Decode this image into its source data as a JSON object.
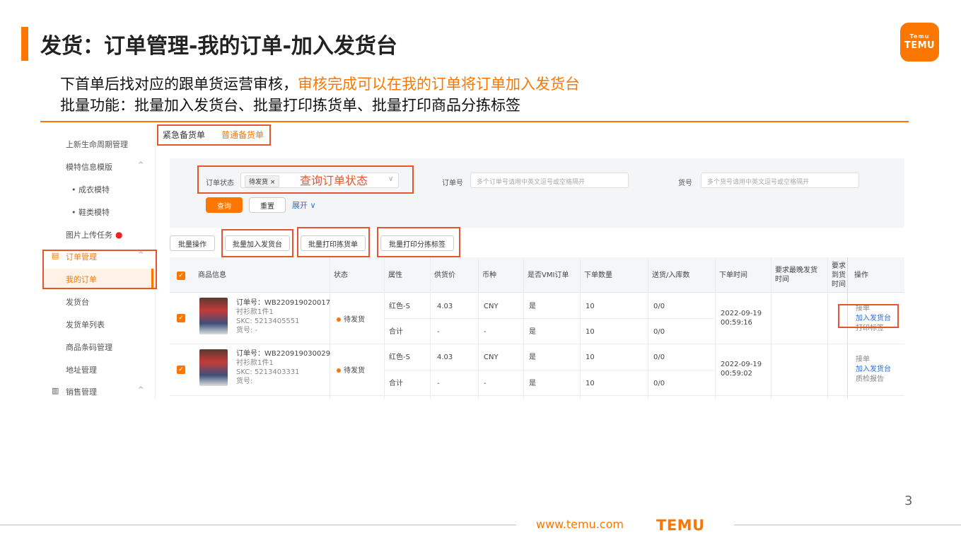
{
  "slide": {
    "title": "发货：订单管理-我的订单-加入发货台",
    "desc_line1_a": "下首单后找对应的跟单货运营审核，",
    "desc_line1_b": "审核完成可以在我的订单将订单加入发货台",
    "desc_line2": "批量功能：批量加入发货台、批量打印拣货单、批量打印商品分拣标签",
    "logo_sub": "Temu",
    "logo_main": "TEMU",
    "page_number": "3",
    "footer_url": "www.temu.com",
    "footer_logo": "TEMU",
    "accent_color": "#fb7701"
  },
  "sidebar": {
    "items": [
      {
        "label": "上新生命周期管理"
      },
      {
        "label": "模特信息模版"
      },
      {
        "label": "• 成衣模特"
      },
      {
        "label": "• 鞋类模特"
      },
      {
        "label": "图片上传任务"
      },
      {
        "label": "订单管理"
      },
      {
        "label": "我的订单"
      },
      {
        "label": "发货台"
      },
      {
        "label": "发货单列表"
      },
      {
        "label": "商品条码管理"
      },
      {
        "label": "地址管理"
      },
      {
        "label": "销售管理"
      }
    ]
  },
  "tabs": {
    "urgent": "紧急备货单",
    "normal": "普通备货单"
  },
  "filters": {
    "order_status_label": "订单状态",
    "order_status_tag": "待发货",
    "order_status_note": "查询订单状态",
    "order_no_label": "订单号",
    "order_no_placeholder": "多个订单号请用中英文逗号或空格隔开",
    "sku_label": "货号",
    "sku_placeholder": "多个货号请用中英文逗号或空格隔开",
    "query_button": "查询",
    "reset_button": "重置",
    "expand_button": "展开 ∨"
  },
  "batch_actions": {
    "ship": "批量操作",
    "add_to_station": "批量加入发货台",
    "print_picking": "批量打印拣货单",
    "print_labels": "批量打印分拣标签"
  },
  "table": {
    "headers": [
      "商品信息",
      "状态",
      "属性",
      "供货价",
      "币种",
      "是否VMI订单",
      "下单数量",
      "送货/入库数",
      "下单时间",
      "要求最晚发货时间",
      "要求到货时间",
      "操作"
    ],
    "rows": [
      {
        "order_no": "订单号：WB220919020017",
        "spec": "衬衫款1件1",
        "skc": "SKC: 5213405551",
        "sku": "货号: -",
        "status": "待发货",
        "attr1": "红色-S",
        "attr2": "合计",
        "price1": "4.03",
        "price2": "-",
        "currency1": "CNY",
        "currency2": "-",
        "vmi1": "是",
        "vmi2": "是",
        "qty1": "10",
        "qty2": "10",
        "delivered1": "0/0",
        "delivered2": "0/0",
        "order_time": "2022-09-19 00:59:16",
        "op1": "接单",
        "op2": "加入发货台",
        "op3": "打印标签"
      },
      {
        "order_no": "订单号：WB220919030029",
        "spec": "衬衫款1件1",
        "skc": "SKC: 5213403331",
        "sku": "货号:",
        "status": "待发货",
        "attr1": "红色-S",
        "attr2": "合计",
        "price1": "4.03",
        "price2": "-",
        "currency1": "CNY",
        "currency2": "-",
        "vmi1": "是",
        "vmi2": "是",
        "qty1": "10",
        "qty2": "10",
        "delivered1": "0/0",
        "delivered2": "0/0",
        "order_time": "2022-09-19 00:59:02",
        "op1": "接单",
        "op2": "加入发货台",
        "op3": "质检报告"
      }
    ]
  }
}
